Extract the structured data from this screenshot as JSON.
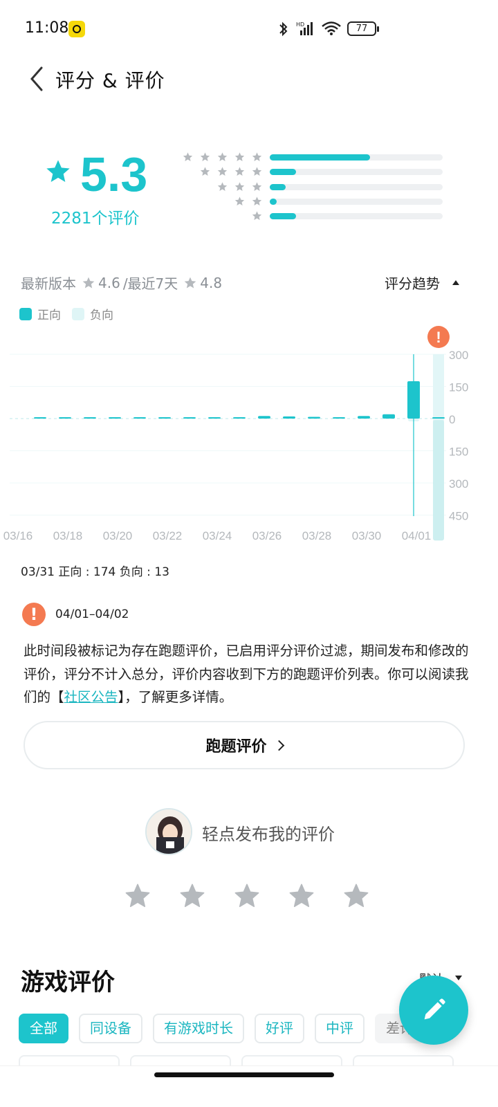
{
  "status_bar": {
    "time": "11:08",
    "battery": "77",
    "icons": [
      "bluetooth-icon",
      "signal-icon",
      "wifi-icon",
      "battery-icon"
    ]
  },
  "header": {
    "title": "评分 & 评价",
    "back_icon": "back-arrow-icon"
  },
  "rating": {
    "score": "5.3",
    "count_label": "2281个评价",
    "distribution": [
      {
        "stars": 5,
        "fraction": 0.58
      },
      {
        "stars": 4,
        "fraction": 0.15
      },
      {
        "stars": 3,
        "fraction": 0.09
      },
      {
        "stars": 2,
        "fraction": 0.04
      },
      {
        "stars": 1,
        "fraction": 0.15
      }
    ]
  },
  "version": {
    "latest_label": "最新版本",
    "latest_score": "4.6",
    "recent_label": "/最近7天",
    "recent_score": "4.8",
    "trend_label": "评分趋势"
  },
  "legend": {
    "positive": "正向",
    "negative": "负向"
  },
  "colors": {
    "accent": "#1dc4cc",
    "negative": "#dff5f6",
    "warning": "#f47a51"
  },
  "chart_data": {
    "type": "bar",
    "x_ticks": [
      "03/16",
      "03/18",
      "03/20",
      "03/22",
      "03/24",
      "03/26",
      "03/28",
      "03/30",
      "04/01"
    ],
    "y_ticks_pos": [
      "300",
      "150",
      "0"
    ],
    "y_ticks_neg": [
      "150",
      "300",
      "450"
    ],
    "ylim": [
      -450,
      300
    ],
    "categories": [
      "03/16",
      "03/17",
      "03/18",
      "03/19",
      "03/20",
      "03/21",
      "03/22",
      "03/23",
      "03/24",
      "03/25",
      "03/26",
      "03/27",
      "03/28",
      "03/29",
      "03/30",
      "03/31",
      "04/01"
    ],
    "series": [
      {
        "name": "正向",
        "values": [
          2,
          2,
          5,
          5,
          3,
          5,
          4,
          0,
          0,
          12,
          10,
          8,
          6,
          12,
          20,
          174,
          0
        ]
      },
      {
        "name": "负向",
        "values": [
          0,
          0,
          0,
          0,
          0,
          0,
          0,
          0,
          0,
          0,
          0,
          0,
          0,
          0,
          0,
          13,
          440
        ]
      }
    ],
    "flagged_date": "04/01"
  },
  "chart_info": "03/31 正向 : 174  负向 : 13",
  "notice": {
    "date_range": "04/01–04/02",
    "text_before": "此时间段被标记为存在跑题评价，已启用评分评价过滤，期间发布和修改的评价，评分不计入总分，评价内容收到下方的跑题评价列表。你可以阅读我们的【",
    "link": "社区公告",
    "text_after": "】，了解更多详情。"
  },
  "offtopic_button": "跑题评价",
  "my_review": {
    "prompt": "轻点发布我的评价"
  },
  "game_reviews": {
    "title": "游戏评价",
    "sort": "默认",
    "filters": [
      "全部",
      "同设备",
      "有游戏时长",
      "好评",
      "中评",
      "差评"
    ]
  }
}
